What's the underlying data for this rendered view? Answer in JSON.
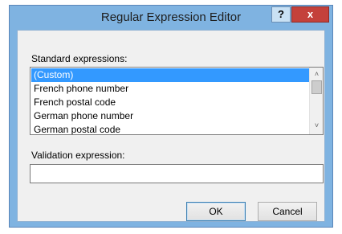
{
  "window": {
    "title": "Regular Expression Editor",
    "help_label": "?",
    "close_label": "x"
  },
  "standard": {
    "label": "Standard expressions:",
    "items": [
      "(Custom)",
      "French phone number",
      "French postal code",
      "German phone number",
      "German postal code"
    ],
    "selected": "(Custom)"
  },
  "validation": {
    "label": "Validation expression:",
    "value": ""
  },
  "buttons": {
    "ok_label": "OK",
    "cancel_label": "Cancel"
  },
  "colors": {
    "selection": "#3399ff",
    "title_bar": "#7fb3e1",
    "close_button": "#c4413b"
  }
}
